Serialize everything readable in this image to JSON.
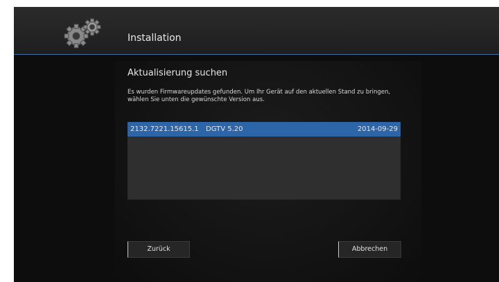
{
  "header": {
    "title": "Installation",
    "icon": "gears-icon"
  },
  "dialog": {
    "title": "Aktualisierung suchen",
    "description": "Es wurden Firmwareupdates gefunden. Um Ihr Gerät auf den aktuellen Stand zu bringen, wählen Sie unten die gewünschte Version aus.",
    "updates": [
      {
        "id": "2132.7221.15615.1",
        "name": "DGTV 5.20",
        "date": "2014-09-29",
        "selected": true
      }
    ]
  },
  "buttons": {
    "back": "Zurück",
    "cancel": "Abbrechen"
  },
  "colors": {
    "accent": "#2d66a8",
    "header_line": "#3d6fa3",
    "background": "#0d0d0d"
  }
}
